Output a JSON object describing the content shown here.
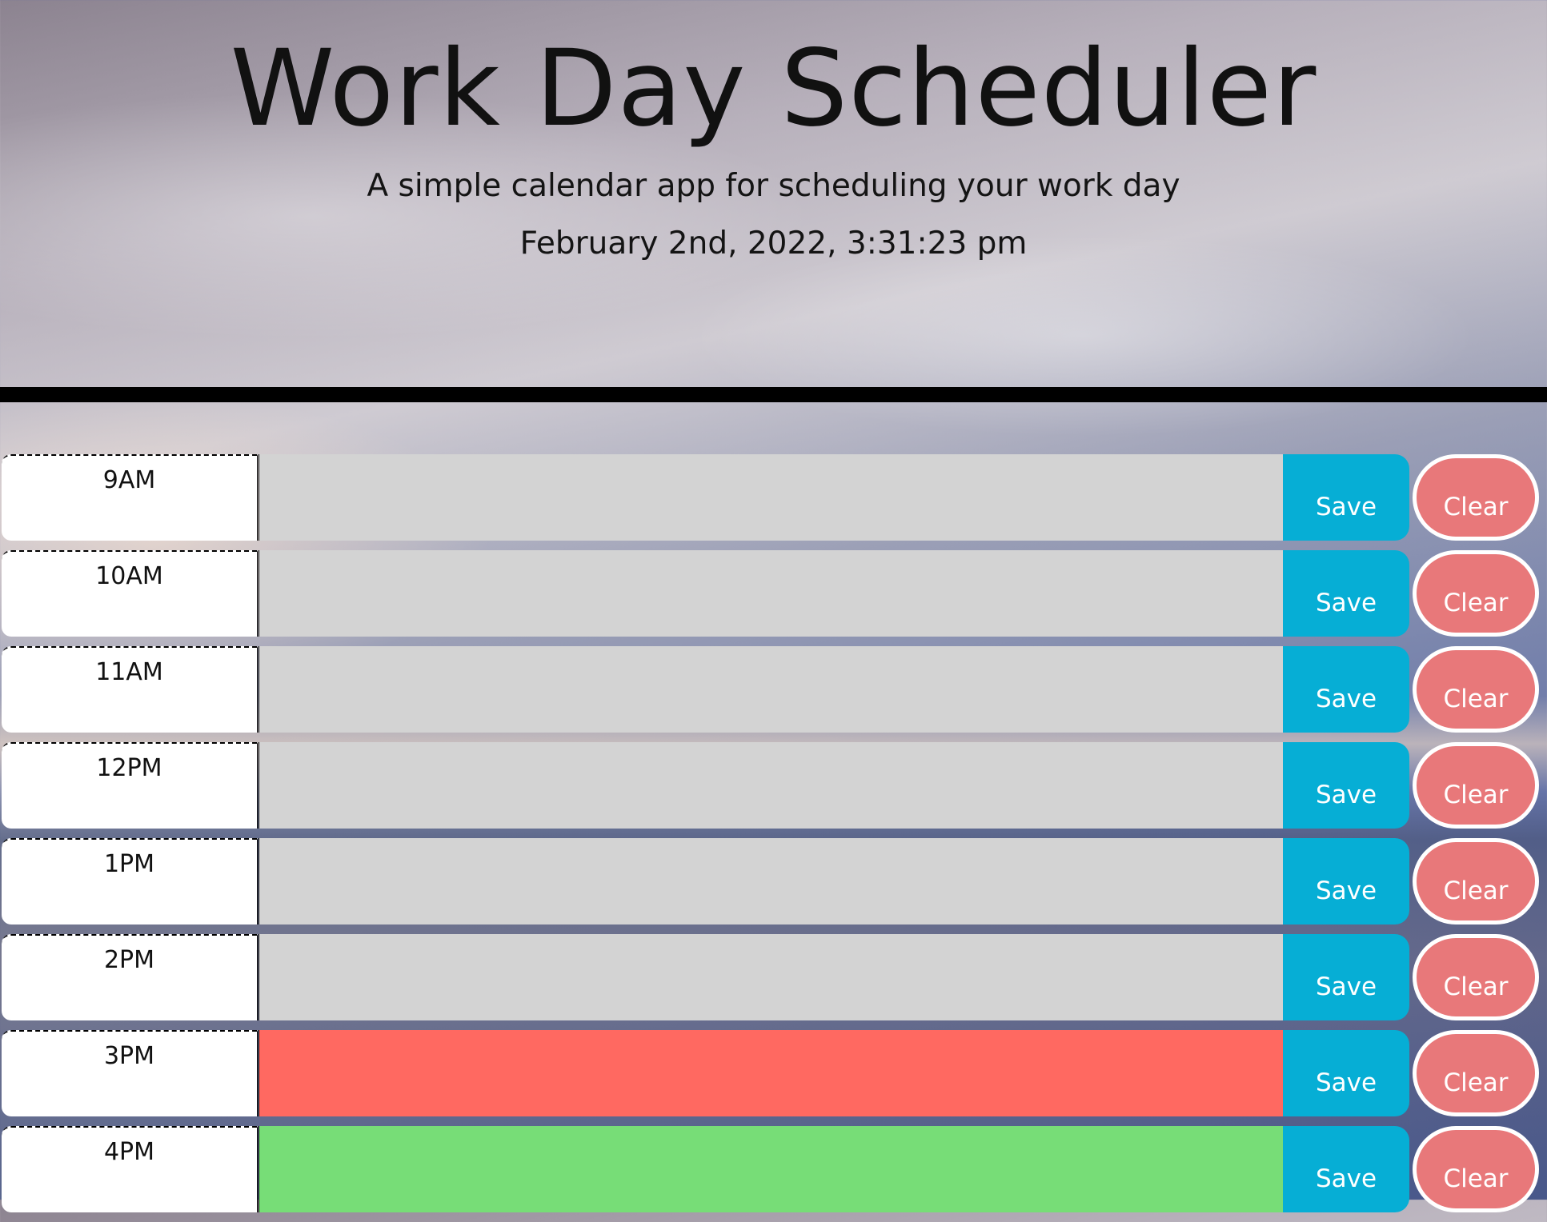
{
  "header": {
    "title": "Work Day Scheduler",
    "subtitle": "A simple calendar app for scheduling your work day",
    "current_datetime": "February 2nd, 2022, 3:31:23 pm"
  },
  "colors": {
    "past": "#d3d3d3",
    "present": "#ff6961",
    "future": "#77dd77",
    "save_button": "#06aed5",
    "clear_button": "#e8787a"
  },
  "schedule": {
    "rows": [
      {
        "hour": "9AM",
        "text": "",
        "state": "past",
        "save_label": "Save",
        "clear_label": "Clear"
      },
      {
        "hour": "10AM",
        "text": "",
        "state": "past",
        "save_label": "Save",
        "clear_label": "Clear"
      },
      {
        "hour": "11AM",
        "text": "",
        "state": "past",
        "save_label": "Save",
        "clear_label": "Clear"
      },
      {
        "hour": "12PM",
        "text": "",
        "state": "past",
        "save_label": "Save",
        "clear_label": "Clear"
      },
      {
        "hour": "1PM",
        "text": "",
        "state": "past",
        "save_label": "Save",
        "clear_label": "Clear"
      },
      {
        "hour": "2PM",
        "text": "",
        "state": "past",
        "save_label": "Save",
        "clear_label": "Clear"
      },
      {
        "hour": "3PM",
        "text": "",
        "state": "present",
        "save_label": "Save",
        "clear_label": "Clear"
      },
      {
        "hour": "4PM",
        "text": "",
        "state": "future",
        "save_label": "Save",
        "clear_label": "Clear"
      }
    ]
  }
}
